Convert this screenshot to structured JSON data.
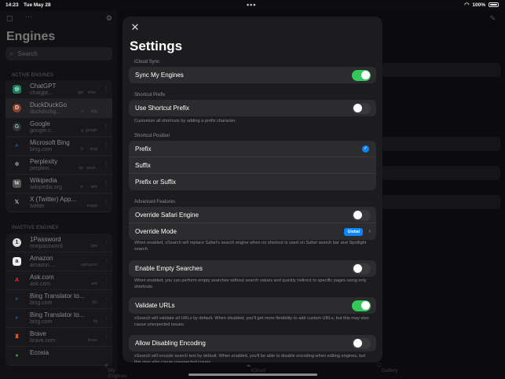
{
  "status_bar": {
    "time": "14:23",
    "date": "Tue May 28",
    "battery": "100%"
  },
  "sidebar": {
    "title": "Engines",
    "search_placeholder": "Search",
    "active_section": "ACTIVE ENGINES",
    "inactive_section": "INACTIVE ENGINES",
    "active_engines": [
      {
        "name": "ChatGPT",
        "url": "chatgpt...",
        "kw1": "gpt",
        "kw2": "char..",
        "icon": "chatgpt-icon"
      },
      {
        "name": "DuckDuckGo",
        "url": "duckduckg...",
        "kw1": "d",
        "kw2": "ddg",
        "icon": "duckduckgo-icon"
      },
      {
        "name": "Google",
        "url": "google.c...",
        "kw1": "g",
        "kw2": "google",
        "icon": "google-icon"
      },
      {
        "name": "Microsoft Bing",
        "url": "bing.com",
        "kw1": "b",
        "kw2": "bing",
        "icon": "bing-icon"
      },
      {
        "name": "Perplexity",
        "url": "perplexi...",
        "kw1": "pp",
        "kw2": "perpl..",
        "icon": "perplexity-icon"
      },
      {
        "name": "Wikipedia",
        "url": "wikipedia.org",
        "kw1": "w",
        "kw2": "wiki",
        "icon": "wikipedia-icon"
      },
      {
        "name": "X (Twitter) App...",
        "url": "twitter",
        "kw1": "",
        "kw2": "twapp",
        "icon": "x-icon"
      }
    ],
    "inactive_engines": [
      {
        "name": "1Password",
        "url": "onepassword",
        "kw1": "",
        "kw2": "1pw",
        "icon": "1password-icon"
      },
      {
        "name": "Amazon",
        "url": "amazon....",
        "kw1": "a",
        "kw2": "amazon",
        "icon": "amazon-icon"
      },
      {
        "name": "Ask.com",
        "url": "ask.com",
        "kw1": "",
        "kw2": "ask",
        "icon": "ask-icon"
      },
      {
        "name": "Bing Translator to...",
        "url": "bing.com",
        "kw1": "",
        "kw2": "btc",
        "icon": "translator-icon"
      },
      {
        "name": "Bing Translator to...",
        "url": "bing.com",
        "kw1": "",
        "kw2": "btj",
        "icon": "translator-icon"
      },
      {
        "name": "Brave",
        "url": "brave.com",
        "kw1": "",
        "kw2": "brave",
        "icon": "brave-icon"
      },
      {
        "name": "Ecosia",
        "url": "",
        "kw1": "",
        "kw2": "",
        "icon": "ecosia-icon"
      }
    ]
  },
  "tabs": {
    "my_engines": "My Engines",
    "icloud": "iCloud",
    "gallery": "Gallery"
  },
  "settings": {
    "title": "Settings",
    "icloud_section": "iCloud Sync",
    "sync_label": "Sync My Engines",
    "sync_on": true,
    "prefix_section": "Shortcut Prefix",
    "use_prefix_label": "Use Shortcut Prefix",
    "use_prefix_on": false,
    "prefix_help": "Customize all shortcuts by adding a prefix character.",
    "position_section": "Shortcut Position",
    "position_options": [
      "Prefix",
      "Suffix",
      "Prefix or Suffix"
    ],
    "position_selected": "Prefix",
    "advanced_section": "Advanced Features",
    "override_safari_label": "Override Safari Engine",
    "override_safari_on": false,
    "override_mode_label": "Override Mode",
    "override_mode_value": "Global",
    "override_help": "When enabled, xSearch will replace Safari's search engine when no shortcut is used on Safari search bar and Spotlight search.",
    "empty_search_label": "Enable Empty Searches",
    "empty_search_on": false,
    "empty_search_help": "When enabled, you can perform empty searches without search values and quickly redirect to specific pages using only shortcuts.",
    "validate_urls_label": "Validate URLs",
    "validate_urls_on": true,
    "validate_help": "xSearch will validate all URLs by default. When disabled, you'll get more flexibility to add custom URLs, but this may also cause unexpected issues.",
    "disable_encoding_label": "Allow Disabling Encoding",
    "disable_encoding_on": false,
    "encoding_help": "xSearch will encode search text by default. When enabled, you'll be able to disable encoding when editing engines, but this may also cause unexpected issues."
  },
  "colors": {
    "accent_blue": "#0a84ff",
    "toggle_green": "#34c759",
    "sheet_bg": "#1c1c1e",
    "cell_bg": "#2c2c2e"
  }
}
